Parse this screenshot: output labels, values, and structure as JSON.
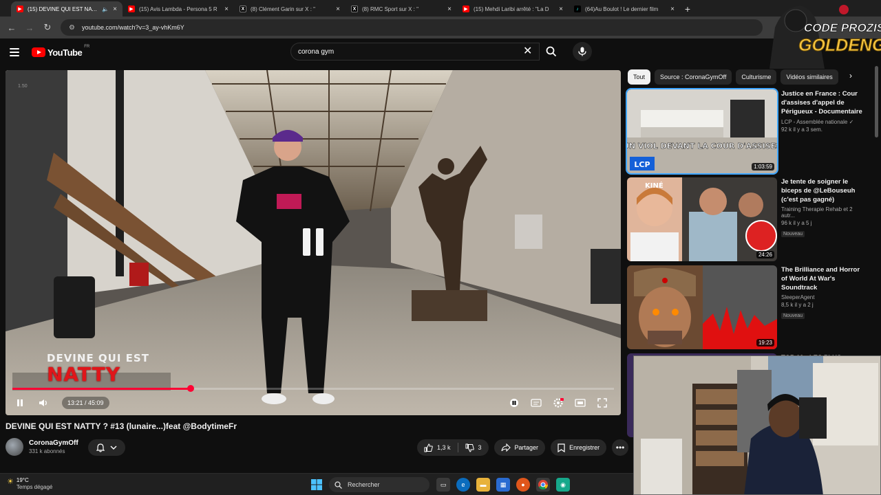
{
  "browser": {
    "tabs": [
      {
        "title": "(15) DEVINE QUI EST NATTY",
        "icon": "youtube-icon",
        "active": true
      },
      {
        "title": "(15) Avis Lambda - Persona 5 R",
        "icon": "youtube-icon",
        "active": false
      },
      {
        "title": "(8) Clément Garin sur X : \"",
        "icon": "x-icon",
        "active": false
      },
      {
        "title": "(8) RMC Sport sur X : \"",
        "icon": "x-icon",
        "active": false
      },
      {
        "title": "(15) Mehdi Laribi arrêté : \"La D",
        "icon": "youtube-icon",
        "active": false
      },
      {
        "title": "(64)Au Boulot ! Le dernier film",
        "icon": "tiktok-icon",
        "active": false
      }
    ],
    "url": "youtube.com/watch?v=3_ay-vhKm6Y"
  },
  "youtube": {
    "logo_text": "YouTube",
    "country": "FR",
    "search_value": "corona gym"
  },
  "video": {
    "overlay_line1": "DEVINE QUI EST",
    "overlay_line2": "NATTY",
    "watermark": "1.50",
    "time": "13:21 / 45:09",
    "progress": 0.296,
    "title": "DEVINE QUI EST NATTY ? #13 (lunaire...)feat @BodytimeFr",
    "channel": "CoronaGymOff",
    "subscribers": "331 k abonnés",
    "likes": "1,3 k",
    "dislikes": "3",
    "share_label": "Partager",
    "save_label": "Enregistrer"
  },
  "sidebar": {
    "chips": [
      "Tout",
      "Source : CoronaGymOff",
      "Culturisme",
      "Vidéos similaires"
    ],
    "recommendations": [
      {
        "title": "Justice en France : Cour d'assises d'appel de Périgueux - Documentaire ...",
        "channel": "LCP - Assemblée nationale ✓",
        "views": "92 k  il y a 3 sem.",
        "duration": "1:03:59",
        "badge": "",
        "thumb_text": "UN VIOL DEVANT LA COUR D'ASSISES",
        "thumb_brand": "LCP"
      },
      {
        "title": "Je tente de soigner le biceps de @LeBouseuh (c'est pas gagné)",
        "channel": "Training Therapie Rehab et 2 autr...",
        "views": "96 k  il y a 5 j",
        "duration": "24:26",
        "badge": "Nouveau",
        "thumb_text": "KINÉ",
        "thumb_brand": ""
      },
      {
        "title": "The Brilliance and Horror of World At War's Soundtrack",
        "channel": "SleeperAgent",
        "views": "8,5 k  il y a 2 j",
        "duration": "19:23",
        "badge": "Nouveau",
        "thumb_text": "",
        "thumb_brand": ""
      },
      {
        "title": "TOP 10 : LES PLUS",
        "channel": "",
        "views": "",
        "duration": "",
        "badge": "",
        "thumb_text": "",
        "thumb_brand": ""
      }
    ]
  },
  "overlay_logo": {
    "line1": "CODE PROZIS",
    "line2": "GOLDENG"
  },
  "taskbar": {
    "temperature": "19°C",
    "weather": "Temps dégagé",
    "search_label": "Rechercher"
  },
  "colors": {
    "accent": "#ff0033",
    "youtube_red": "#ff0000",
    "link_blue": "#3ea6ff"
  }
}
